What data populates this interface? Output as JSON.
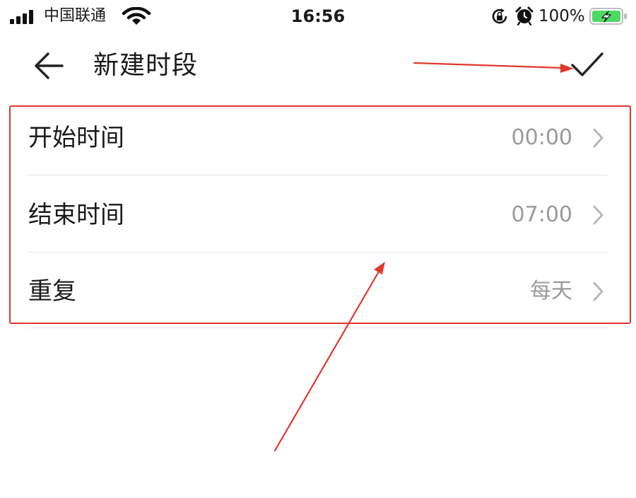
{
  "status_bar": {
    "carrier": "中国联通",
    "time": "16:56",
    "battery": "100%"
  },
  "header": {
    "title": "新建时段",
    "back_icon": "arrow-left-icon",
    "confirm_icon": "checkmark-icon"
  },
  "settings": {
    "rows": [
      {
        "label": "开始时间",
        "value": "00:00"
      },
      {
        "label": "结束时间",
        "value": "07:00"
      },
      {
        "label": "重复",
        "value": "每天"
      }
    ]
  },
  "annotations": {
    "highlight_color": "#e0382f"
  },
  "colors": {
    "battery_green": "#4cd964",
    "secondary_text": "#9a9a9a"
  }
}
